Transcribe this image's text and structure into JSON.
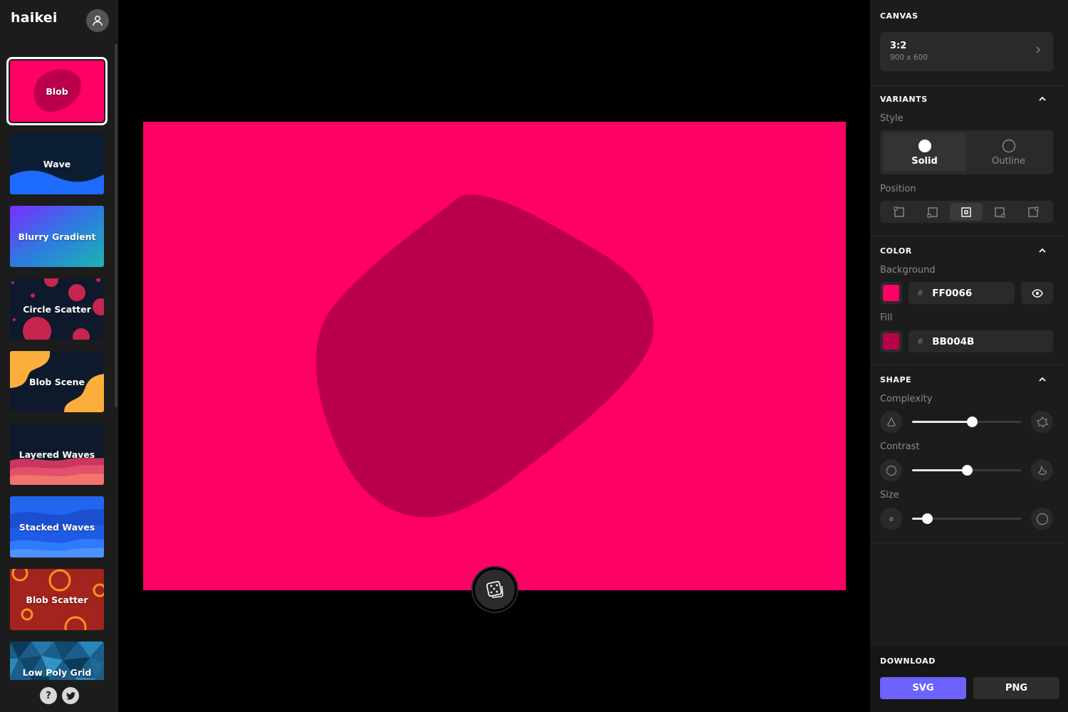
{
  "app": {
    "logo": "haikei"
  },
  "sidebar": {
    "generators": [
      {
        "label": "Blob"
      },
      {
        "label": "Wave"
      },
      {
        "label": "Blurry Gradient"
      },
      {
        "label": "Circle Scatter"
      },
      {
        "label": "Blob Scene"
      },
      {
        "label": "Layered Waves"
      },
      {
        "label": "Stacked Waves"
      },
      {
        "label": "Blob Scatter"
      },
      {
        "label": "Low Poly Grid"
      }
    ],
    "active_index": 0,
    "footer": {
      "help": "?"
    }
  },
  "canvas": {
    "background": "#FF0066",
    "fill": "#BB004B"
  },
  "panel": {
    "canvas": {
      "title": "CANVAS",
      "ratio": "3:2",
      "dims": "900 x 600"
    },
    "variants": {
      "title": "VARIANTS",
      "style_label": "Style",
      "style_options": [
        "Solid",
        "Outline"
      ],
      "style_selected": "Solid",
      "position_label": "Position",
      "position_selected_index": 2
    },
    "color": {
      "title": "COLOR",
      "background_label": "Background",
      "background_hex": "FF0066",
      "fill_label": "Fill",
      "fill_hex": "BB004B",
      "hash": "#"
    },
    "shape": {
      "title": "SHAPE",
      "complexity_label": "Complexity",
      "complexity": 0.55,
      "contrast_label": "Contrast",
      "contrast": 0.5,
      "size_label": "Size",
      "size": 0.14
    },
    "download": {
      "title": "DOWNLOAD",
      "svg": "SVG",
      "png": "PNG"
    }
  },
  "colors": {
    "accent": "#6C63FF",
    "panel": "#1C1C1C",
    "control": "#2A2A2A"
  }
}
